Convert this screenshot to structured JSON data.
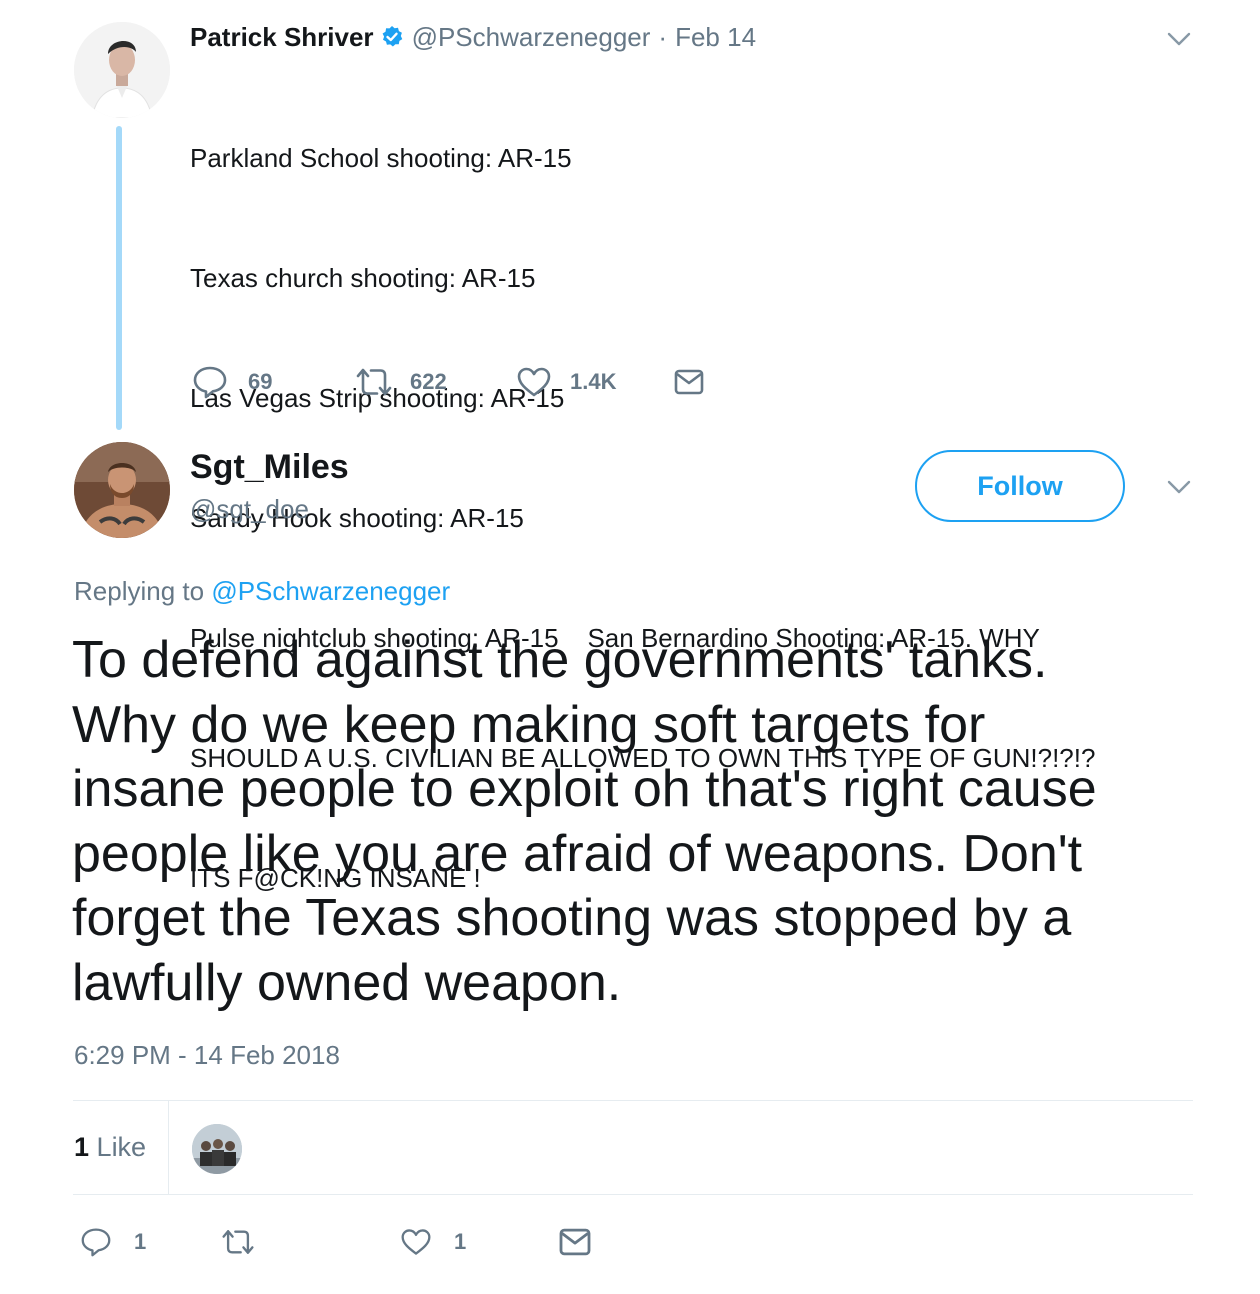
{
  "parent_tweet": {
    "name": "Patrick Shriver",
    "handle": "@PSchwarzenegger",
    "separator": "·",
    "date": "Feb 14",
    "lines": [
      "Parkland School shooting: AR-15",
      "Texas church shooting: AR-15",
      "Las Vegas Strip shooting: AR-15",
      "Sandy Hook shooting: AR-15",
      "Pulse nightclub shooting: AR-15    San Bernardino Shooting: AR-15. WHY",
      "SHOULD A U.S. CIVILIAN BE ALLOWED TO OWN THIS TYPE OF GUN!?!?!?",
      "ITS F@CK!NG INSANE !"
    ],
    "reply_count": "69",
    "retweet_count": "622",
    "like_count": "1.4K"
  },
  "reply_tweet": {
    "name": "Sgt_Miles",
    "handle": "@sgt_doe",
    "follow_label": "Follow",
    "replying_prefix": "Replying to",
    "replying_to": "@PSchwarzenegger",
    "lines": [
      "To defend against the governments' tanks.",
      "Why do we keep making soft targets for",
      "insane people to exploit oh that's right cause",
      "people like you are afraid of weapons. Don't",
      "forget the Texas shooting was stopped by a",
      "lawfully owned weapon."
    ],
    "timestamp": "6:29 PM - 14 Feb 2018",
    "likes_number": "1",
    "likes_label": "Like",
    "reply_count": "1",
    "retweet_count": "",
    "like_count": "1"
  },
  "colors": {
    "accent": "#1da1f2",
    "muted": "#657786",
    "text": "#14171a",
    "thread_line": "#a4d9f9",
    "divider": "#e6ecf0"
  },
  "icons": [
    "verified-badge-icon",
    "chevron-down-icon",
    "reply-icon",
    "retweet-icon",
    "heart-icon",
    "mail-icon"
  ]
}
